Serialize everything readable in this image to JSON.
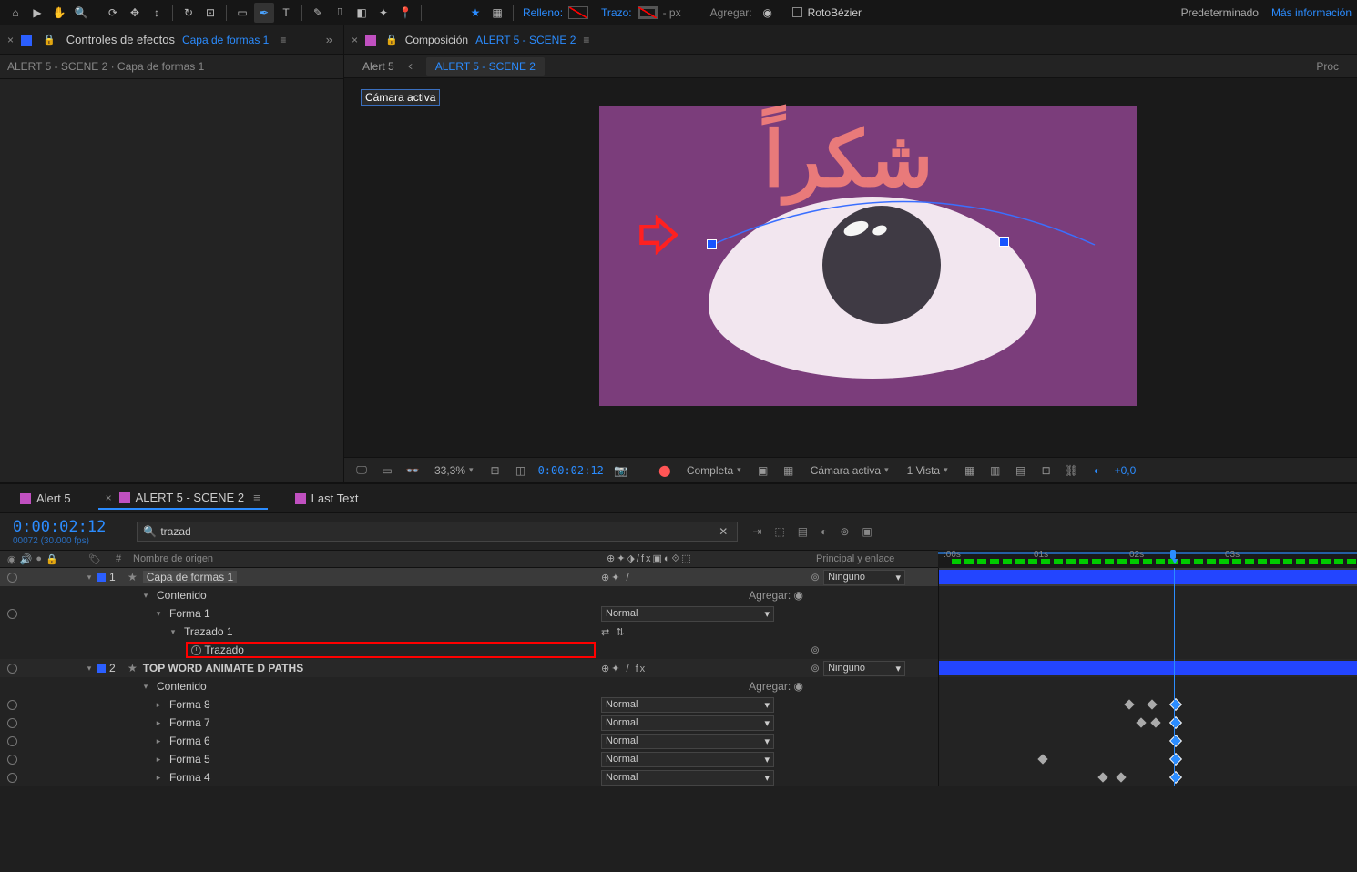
{
  "toolbar": {
    "fill_label": "Relleno:",
    "stroke_label": "Trazo:",
    "stroke_px": "- px",
    "add_label": "Agregar:",
    "rotobezier": "RotoBézier",
    "preset": "Predeterminado",
    "more": "Más información"
  },
  "left_panel": {
    "title": "Controles de efectos",
    "link": "Capa de formas 1",
    "sub": "ALERT 5 - SCENE 2 · Capa de formas 1",
    "close": "×"
  },
  "comp": {
    "prefix": "Composición",
    "name": "ALERT 5 - SCENE 2",
    "close": "×",
    "bc1": "Alert 5",
    "bc_sep": "<",
    "bc2": "ALERT 5 - SCENE 2",
    "bc_right": "Proc",
    "camera": "Cámara activa",
    "arabic": "شكراً"
  },
  "footer": {
    "zoom": "33,3%",
    "time": "0:00:02:12",
    "quality": "Completa",
    "view_mode": "Cámara activa",
    "views": "1 Vista",
    "offset": "+0,0"
  },
  "timeline": {
    "tab1": "Alert 5",
    "tab2": "ALERT 5 - SCENE 2",
    "tab3": "Last Text",
    "time": "0:00:02:12",
    "frames": "00072 (30.000 fps)",
    "search": "trazad",
    "search_placeholder": "",
    "col_num": "#",
    "col_name": "Nombre de origen",
    "col_parent": "Principal y enlace",
    "add": "Agregar:",
    "none": "Ninguno",
    "normal": "Normal",
    "ruler": {
      "t0": ":00s",
      "t1": "01s",
      "t2": "02s",
      "t3": "03s"
    },
    "layers": {
      "l1_num": "1",
      "l1_name": "Capa de formas 1",
      "contenido": "Contenido",
      "forma1": "Forma 1",
      "trazado1": "Trazado 1",
      "trazado": "Trazado",
      "l2_num": "2",
      "l2_name": "TOP WORD ANIMATE D PATHS",
      "forma8": "Forma 8",
      "forma7": "Forma 7",
      "forma6": "Forma 6",
      "forma5": "Forma 5",
      "forma4": "Forma 4"
    }
  }
}
